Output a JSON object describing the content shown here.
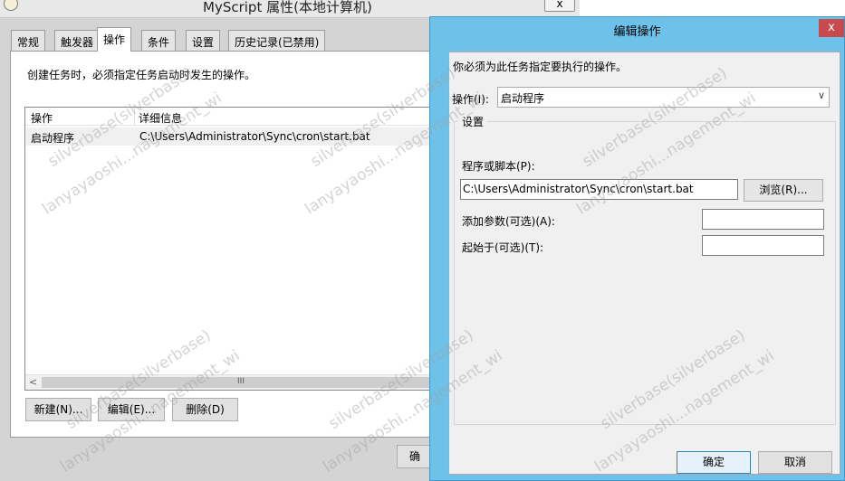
{
  "bg_window": {
    "title": "MyScript 属性(本地计算机)",
    "close_glyph": "x",
    "tabs": [
      "常规",
      "触发器",
      "操作",
      "条件",
      "设置",
      "历史记录(已禁用)"
    ],
    "active_tab": "操作",
    "description": "创建任务时，必须指定任务启动时发生的操作。",
    "table": {
      "columns": [
        "操作",
        "详细信息"
      ],
      "rows": [
        {
          "action": "启动程序",
          "details": "C:\\Users\\Administrator\\Sync\\cron\\start.bat"
        }
      ],
      "scroll_left_glyph": "<",
      "scroll_thumb_glyph": "III"
    },
    "buttons": {
      "new": "新建(N)...",
      "edit": "编辑(E)...",
      "delete": "删除(D)"
    },
    "ok_partial": "确"
  },
  "dialog": {
    "title": "编辑操作",
    "close_glyph": "x",
    "prompt": "你必须为此任务指定要执行的操作。",
    "action_label": "操作(I):",
    "action_value": "启动程序",
    "settings_legend": "设置",
    "program_label": "程序或脚本(P):",
    "program_value": "C:\\Users\\Administrator\\Sync\\cron\\start.bat",
    "browse": "浏览(R)...",
    "args_label": "添加参数(可选)(A):",
    "args_value": "",
    "startin_label": "起始于(可选)(T):",
    "startin_value": "",
    "ok": "确定",
    "cancel": "取消"
  },
  "watermark": {
    "line1": "silverbase(silverbase)",
    "line2": "lanyayaoshi...nagement_wi"
  }
}
